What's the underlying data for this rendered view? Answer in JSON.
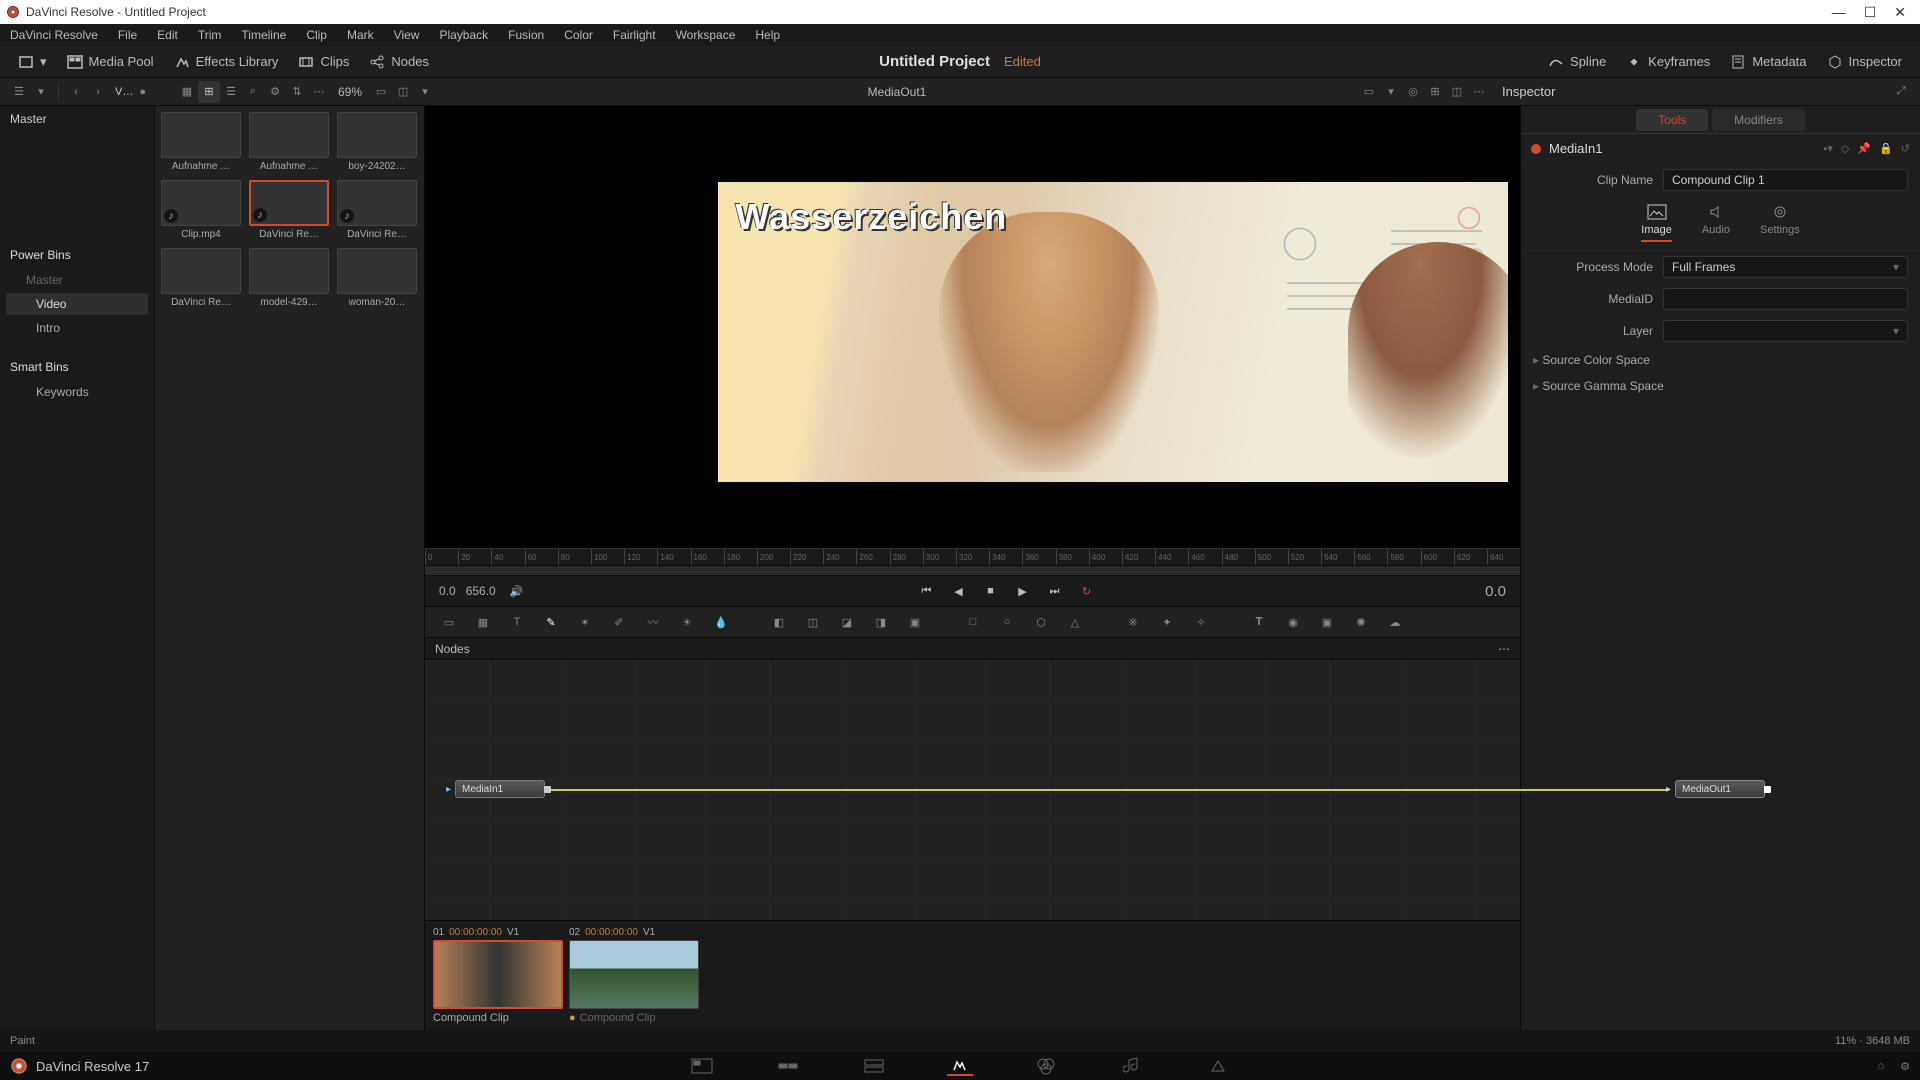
{
  "window": {
    "title": "DaVinci Resolve - Untitled Project"
  },
  "menus": [
    "DaVinci Resolve",
    "File",
    "Edit",
    "Trim",
    "Timeline",
    "Clip",
    "Mark",
    "View",
    "Playback",
    "Fusion",
    "Color",
    "Fairlight",
    "Workspace",
    "Help"
  ],
  "toolbar": {
    "media_pool": "Media Pool",
    "effects": "Effects Library",
    "clips": "Clips",
    "nodes": "Nodes",
    "spline": "Spline",
    "keyframes": "Keyframes",
    "metadata": "Metadata",
    "inspector": "Inspector",
    "project": "Untitled Project",
    "edited": "Edited"
  },
  "secondbar": {
    "sort_label": "V…",
    "zoom": "69%",
    "viewer_name": "MediaOut1",
    "inspector_title": "Inspector"
  },
  "sidebar": {
    "master": "Master",
    "power_bins": "Power Bins",
    "power_master": "Master",
    "video": "Video",
    "intro": "Intro",
    "smart_bins": "Smart Bins",
    "keywords": "Keywords"
  },
  "clips": [
    {
      "label": "Aufnahme …",
      "thumb": "th-green"
    },
    {
      "label": "Aufnahme …",
      "thumb": "th-people"
    },
    {
      "label": "boy-24202…",
      "thumb": "th-boy"
    },
    {
      "label": "Clip.mp4",
      "thumb": "th-couple",
      "audio": true
    },
    {
      "label": "DaVinci Re…",
      "thumb": "th-land",
      "audio": true,
      "selected": true
    },
    {
      "label": "DaVinci Re…",
      "thumb": "th-land",
      "audio": true
    },
    {
      "label": "DaVinci Re…",
      "thumb": "th-tree"
    },
    {
      "label": "model-429…",
      "thumb": "th-woman"
    },
    {
      "label": "woman-20…",
      "thumb": "th-woman"
    }
  ],
  "viewer": {
    "watermark": "Wasserzeichen"
  },
  "ruler_ticks": [
    "0",
    "20",
    "40",
    "60",
    "80",
    "100",
    "120",
    "140",
    "160",
    "180",
    "200",
    "220",
    "240",
    "260",
    "280",
    "300",
    "320",
    "340",
    "360",
    "380",
    "400",
    "420",
    "440",
    "460",
    "480",
    "500",
    "520",
    "540",
    "560",
    "580",
    "600",
    "620",
    "640"
  ],
  "transport": {
    "start": "0.0",
    "end": "656.0",
    "out": "0.0"
  },
  "nodes": {
    "title": "Nodes",
    "in": "MediaIn1",
    "out": "MediaOut1"
  },
  "clips_strip": [
    {
      "num": "01",
      "tc": "00:00:00:00",
      "track": "V1",
      "label": "Compound Clip",
      "thumb": "th-couple",
      "active": true
    },
    {
      "num": "02",
      "tc": "00:00:00:00",
      "track": "V1",
      "label": "Compound Clip",
      "thumb": "th-land",
      "unused": true
    }
  ],
  "inspector": {
    "tab_tools": "Tools",
    "tab_modifiers": "Modifiers",
    "node_name": "MediaIn1",
    "tabs2": {
      "image": "Image",
      "audio": "Audio",
      "settings": "Settings"
    },
    "clip_name_lbl": "Clip Name",
    "clip_name_val": "Compound Clip 1",
    "process_mode_lbl": "Process Mode",
    "process_mode_val": "Full Frames",
    "mediaid_lbl": "MediaID",
    "layer_lbl": "Layer",
    "source_color": "Source Color Space",
    "source_gamma": "Source Gamma Space"
  },
  "status": {
    "tool": "Paint",
    "mem": "11% · 3648 MB"
  },
  "pagebar": {
    "app": "DaVinci Resolve 17"
  }
}
